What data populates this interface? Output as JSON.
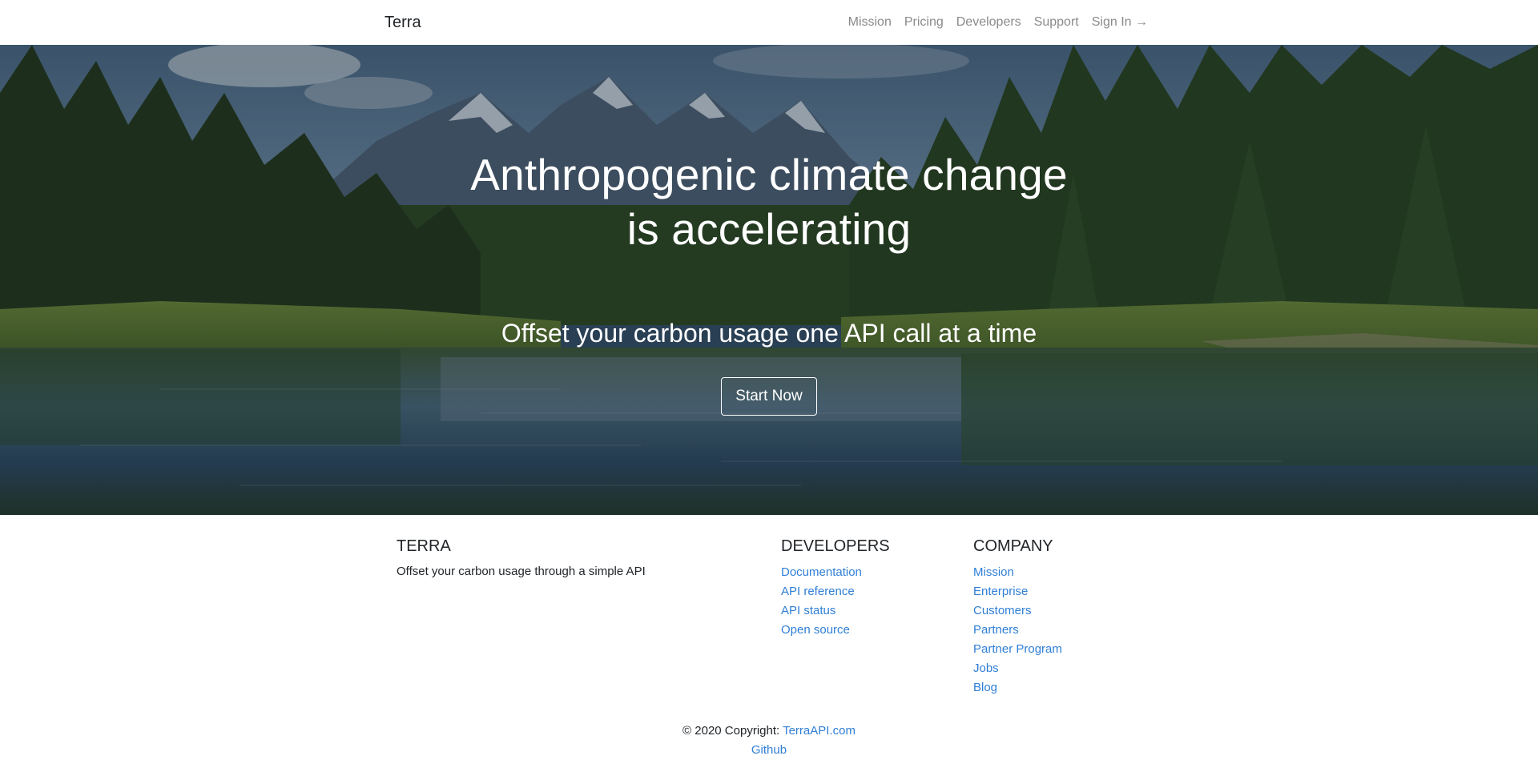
{
  "navbar": {
    "brand": "Terra",
    "links": [
      "Mission",
      "Pricing",
      "Developers",
      "Support",
      "Sign In →"
    ]
  },
  "hero": {
    "title": "Anthropogenic climate change is accelerating",
    "subtitle": "Offset your carbon usage one API call at a time",
    "cta_label": "Start Now"
  },
  "footer": {
    "terra": {
      "heading": "TERRA",
      "description": "Offset your carbon usage through a simple API"
    },
    "developers": {
      "heading": "DEVELOPERS",
      "links": [
        "Documentation",
        "API reference",
        "API status",
        "Open source"
      ]
    },
    "company": {
      "heading": "COMPANY",
      "links": [
        "Mission",
        "Enterprise",
        "Customers",
        "Partners",
        "Partner Program",
        "Jobs",
        "Blog"
      ]
    },
    "copyright": {
      "prefix": "© 2020 Copyright: ",
      "site_link": "TerraAPI.com",
      "github_link": "Github"
    }
  },
  "colors": {
    "link": "#2f7fd6",
    "nav_link": "#8a8a8a",
    "text": "#212529"
  }
}
